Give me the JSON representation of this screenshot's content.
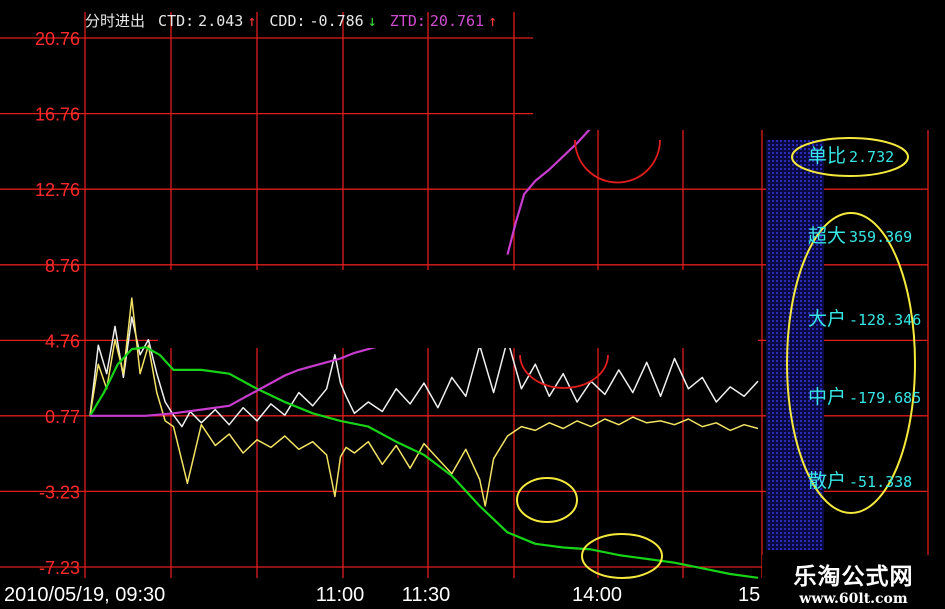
{
  "header": {
    "indicator_name": "分时进出",
    "ctd_label": "CTD:",
    "ctd_value": "2.043",
    "ctd_arrow": "↑",
    "cdd_label": "CDD:",
    "cdd_value": "-0.786",
    "cdd_arrow": "↓",
    "ztd_label": "ZTD:",
    "ztd_value": "20.761",
    "ztd_arrow": "↑"
  },
  "side_panel": {
    "rows": [
      {
        "label": "单比",
        "value": "2.732"
      },
      {
        "label": "超大",
        "value": "359.369"
      },
      {
        "label": "大户",
        "value": "-128.346"
      },
      {
        "label": "中户",
        "value": "-179.685"
      },
      {
        "label": "散户",
        "value": "-51.338"
      }
    ]
  },
  "brand": {
    "name": "乐淘公式网",
    "url": "www.60lt.com"
  },
  "colors": {
    "grid": "#e11d1d",
    "axis_text": "#ff2a2a",
    "white_series": "#f0f0f0",
    "yellow_series": "#f2e264",
    "green_series": "#17d417",
    "magenta_series": "#c83ccf",
    "annotation": "#f4e93c",
    "panel_label": "#37e6e6"
  },
  "chart_data": {
    "type": "line",
    "title": "",
    "x_ticks": [
      "2010/05/19, 09:30",
      "11:00",
      "11:30",
      "14:00",
      "15"
    ],
    "y_ticks": [
      "20.76",
      "16.76",
      "12.76",
      "8.76",
      "4.76",
      "0.77",
      "-3.23",
      "-7.23"
    ],
    "ylim": [
      -7.23,
      20.76
    ],
    "x_domain_minutes": [
      0,
      240
    ],
    "grid": true,
    "series": [
      {
        "color": "white",
        "x": [
          0,
          3,
          6,
          9,
          12,
          15,
          18,
          21,
          24,
          27,
          30,
          33,
          36,
          40,
          45,
          50,
          55,
          60,
          65,
          70,
          75,
          80,
          85,
          88,
          90,
          92,
          95,
          100,
          105,
          110,
          115,
          120,
          125,
          130,
          135,
          140,
          145,
          150,
          155,
          160,
          165,
          170,
          175,
          180,
          185,
          190,
          195,
          200,
          205,
          210,
          215,
          220,
          225,
          230,
          235,
          240
        ],
        "y": [
          0.77,
          4.5,
          3,
          5.5,
          2.8,
          6,
          4,
          4.8,
          3,
          1.5,
          0.8,
          0.2,
          1.0,
          0.4,
          1.1,
          0.3,
          1.2,
          0.5,
          1.4,
          0.8,
          2.0,
          1.3,
          2.2,
          4.0,
          2.5,
          1.8,
          0.9,
          1.5,
          1.0,
          2.2,
          1.4,
          2.5,
          1.2,
          2.8,
          1.8,
          4.5,
          2.0,
          4.8,
          2.2,
          3.5,
          1.8,
          3.0,
          1.5,
          2.6,
          1.9,
          3.2,
          2.0,
          3.6,
          1.8,
          3.8,
          2.2,
          2.8,
          1.5,
          2.3,
          1.8,
          2.6
        ]
      },
      {
        "color": "yellow",
        "x": [
          0,
          3,
          6,
          9,
          12,
          15,
          18,
          21,
          24,
          27,
          30,
          35,
          40,
          45,
          50,
          55,
          60,
          65,
          70,
          75,
          80,
          85,
          88,
          90,
          92,
          95,
          100,
          105,
          110,
          115,
          120,
          125,
          130,
          135,
          140,
          142,
          145,
          150,
          155,
          160,
          165,
          170,
          175,
          180,
          185,
          190,
          195,
          200,
          205,
          210,
          215,
          220,
          225,
          230,
          235,
          240
        ],
        "y": [
          0.77,
          3.5,
          2.2,
          4.8,
          3,
          7,
          3,
          4.5,
          2,
          0.5,
          0.2,
          -2.8,
          0.3,
          -0.8,
          -0.2,
          -1.2,
          -0.5,
          -0.9,
          -0.3,
          -1.0,
          -0.6,
          -1.3,
          -3.5,
          -1.4,
          -0.9,
          -1.2,
          -0.6,
          -1.8,
          -0.8,
          -2.0,
          -0.7,
          -1.5,
          -2.3,
          -1.0,
          -2.6,
          -4.0,
          -1.5,
          -0.3,
          0.2,
          0.0,
          0.4,
          0.1,
          0.5,
          0.2,
          0.6,
          0.3,
          0.7,
          0.4,
          0.5,
          0.3,
          0.6,
          0.2,
          0.4,
          0.0,
          0.3,
          0.1
        ]
      },
      {
        "color": "green",
        "x": [
          0,
          5,
          10,
          15,
          20,
          25,
          30,
          40,
          50,
          60,
          70,
          80,
          90,
          100,
          110,
          120,
          130,
          140,
          150,
          160,
          170,
          180,
          190,
          200,
          210,
          220,
          230,
          240
        ],
        "y": [
          0.77,
          2.0,
          3.5,
          4.3,
          4.4,
          4.0,
          3.2,
          3.2,
          3.0,
          2.2,
          1.5,
          0.9,
          0.5,
          0.2,
          -0.6,
          -1.3,
          -2.4,
          -4.0,
          -5.4,
          -6.0,
          -6.2,
          -6.3,
          -6.6,
          -6.8,
          -7.0,
          -7.3,
          -7.6,
          -7.8
        ]
      },
      {
        "color": "magenta",
        "x": [
          0,
          10,
          20,
          30,
          40,
          50,
          55,
          60,
          65,
          70,
          75,
          80,
          85,
          90,
          95,
          100,
          105,
          110
        ],
        "y": [
          0.77,
          0.77,
          0.77,
          0.9,
          1.1,
          1.3,
          1.7,
          2.1,
          2.5,
          2.9,
          3.2,
          3.4,
          3.6,
          3.8,
          4.1,
          4.3,
          4.5,
          4.6
        ]
      },
      {
        "color": "magenta",
        "x": [
          150,
          153,
          156,
          160,
          165,
          170,
          175,
          180,
          185,
          190
        ],
        "y": [
          9.3,
          11,
          12.5,
          13.2,
          13.8,
          14.5,
          15.2,
          16,
          16.6,
          17.2
        ]
      }
    ]
  }
}
